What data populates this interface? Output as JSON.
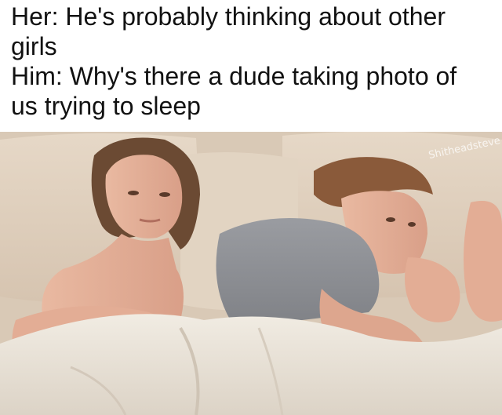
{
  "caption": {
    "lines": [
      "Her: He's probably thinking about other",
      "girls",
      "Him: Why's there a dude taking photo of",
      "us trying to sleep"
    ]
  },
  "photo": {
    "subject": "woman and man lying in bed with backs turned",
    "watermark": "Shitheadsteve"
  }
}
